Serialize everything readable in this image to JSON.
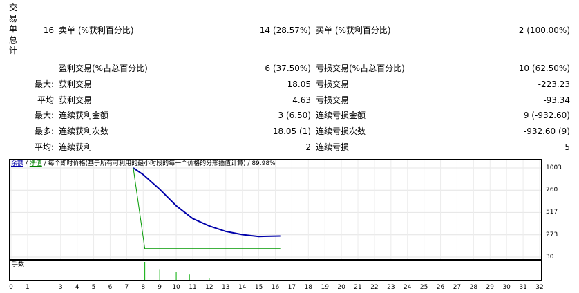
{
  "summary": {
    "total_trades_vertical_label": [
      "交",
      "易",
      "单",
      "总",
      "计"
    ],
    "total_trades_value": "16",
    "short_label": "卖单 (%获利百分比)",
    "short_value": "14 (28.57%)",
    "long_label": "买单 (%获利百分比)",
    "long_value": "2 (100.00%)",
    "profit_trades_label": "盈利交易(%占总百分比)",
    "profit_trades_value": "6 (37.50%)",
    "loss_trades_label": "亏损交易(%占总百分比)",
    "loss_trades_value": "10 (62.50%)"
  },
  "stats_rows": [
    {
      "prefix": "最大:",
      "left_label": "获利交易",
      "left_value": "18.05",
      "right_label": "亏损交易",
      "right_value": "-223.23"
    },
    {
      "prefix": "平均",
      "left_label": "获利交易",
      "left_value": "4.63",
      "right_label": "亏损交易",
      "right_value": "-93.34"
    },
    {
      "prefix": "最大:",
      "left_label": "连续获利金额",
      "left_value": "3 (6.50)",
      "right_label": "连续亏损金额",
      "right_value": "9 (-932.60)"
    },
    {
      "prefix": "最多:",
      "left_label": "连续获利次数",
      "left_value": "18.05 (1)",
      "right_label": "连续亏损次数",
      "right_value": "-932.60 (9)"
    },
    {
      "prefix": "平均:",
      "left_label": "连续获利",
      "left_value": "2",
      "right_label": "连续亏损",
      "right_value": "5"
    }
  ],
  "chart_header": {
    "balance_label": "余额",
    "sep1": " / ",
    "equity_label": "净值",
    "description": " / 每个即时价格(基于所有可利用的最小时段的每一个价格的分形插值计算) / 89.98%"
  },
  "volume_label": "手数",
  "colors": {
    "balance": "#0000aa",
    "equity": "#009900",
    "volume": "#00aa00"
  },
  "chart_data": {
    "type": "line",
    "title": "每个即时价格(基于所有可利用的最小时段的每一个价格的分形插值计算) / 89.98%",
    "xlabel": "",
    "ylabel": "",
    "ylim": [
      30,
      1003
    ],
    "xlim": [
      0,
      32
    ],
    "y_ticks": [
      "1003",
      "760",
      "517",
      "273",
      "30"
    ],
    "x_ticks": [
      "0",
      "1",
      "3",
      "4",
      "5",
      "6",
      "7",
      "8",
      "9",
      "10",
      "11",
      "12",
      "13",
      "14",
      "15",
      "16",
      "17",
      "18",
      "19",
      "20",
      "21",
      "22",
      "23",
      "24",
      "25",
      "26",
      "27",
      "28",
      "29",
      "30",
      "31",
      "32"
    ],
    "grid": true,
    "series": [
      {
        "name": "余额",
        "x": [
          7.4,
          8.0,
          9.0,
          10.0,
          11.0,
          12.0,
          13.0,
          14.0,
          15.0,
          16.3
        ],
        "values": [
          1003,
          930,
          770,
          590,
          450,
          370,
          310,
          275,
          255,
          260
        ]
      },
      {
        "name": "净值",
        "x": [
          7.4,
          8.1,
          8.1,
          16.3
        ],
        "values": [
          1003,
          123,
          123,
          123
        ]
      }
    ],
    "volume": {
      "name": "手数",
      "x": [
        8.1,
        9.0,
        10.0,
        10.8,
        12.0
      ],
      "values": [
        1.0,
        0.6,
        0.45,
        0.3,
        0.1
      ]
    }
  }
}
